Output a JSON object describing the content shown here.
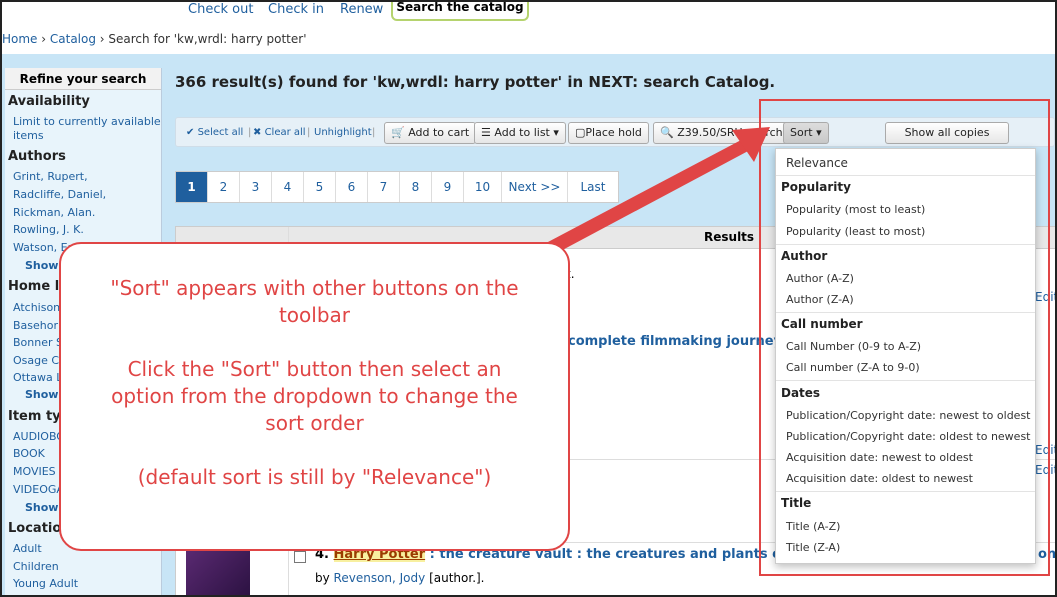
{
  "topnav": {
    "checkout": "Check out",
    "checkin": "Check in",
    "renew": "Renew",
    "search_tab": "Search the catalog"
  },
  "breadcrumb": {
    "home": "Home",
    "sep1": " › ",
    "catalog": "Catalog",
    "sep2": " › ",
    "current": "Search for 'kw,wrdl: harry potter'"
  },
  "sidebar": {
    "refine": "Refine your search",
    "availability": "Availability",
    "avail_link1": "Limit to currently available",
    "avail_link2": "items",
    "authors": "Authors",
    "authors_list": [
      "Grint, Rupert,",
      "Radcliffe, Daniel,",
      "Rickman, Alan.",
      "Rowling, J. K.",
      "Watson, Em"
    ],
    "show": "Show",
    "home_libraries": "Home lib",
    "libraries": [
      "Atchison",
      "Basehor",
      "Bonner S",
      "Osage Ci",
      "Ottawa L"
    ],
    "item_types": "Item typ",
    "types": [
      "AUDIOBO",
      "BOOK",
      "MOVIES",
      "VIDEOGA"
    ],
    "locations": "Location",
    "locs": [
      "Adult",
      "Children",
      "Young Adult"
    ]
  },
  "results_title": "366 result(s) found for 'kw,wrdl: harry potter' in NEXT: search Catalog.",
  "toolbar": {
    "select_all": "Select all",
    "clear_all": "Clear all",
    "unhighlight": "Unhighlight",
    "add_to_cart": "Add to cart",
    "add_to_list": "Add to list",
    "place_hold": "Place hold",
    "z3950": "Z39.50/SRU search",
    "sort": "Sort",
    "show_all_copies": "Show all copies"
  },
  "pager": {
    "pages": [
      "1",
      "2",
      "3",
      "4",
      "5",
      "6",
      "7",
      "8",
      "9",
      "10"
    ],
    "next": "Next >>",
    "last": "Last"
  },
  "table": {
    "results_header": "Results",
    "frag_t": "t.",
    "frag_title2": "complete filmmaking journey /",
    "row4_num": "4.",
    "row4_title": "Harry Potter",
    "row4_rest": " : the creature vault : the creatures and plants of the",
    "row4_tail": "on",
    "row4_by": "by",
    "row4_author": "Revenson, Jody",
    "row4_role": " [author.].",
    "edit": "Edit"
  },
  "dropdown": {
    "relevance": "Relevance",
    "popularity": "Popularity",
    "pop_most": "Popularity (most to least)",
    "pop_least": "Popularity (least to most)",
    "author": "Author",
    "author_az": "Author (A-Z)",
    "author_za": "Author (Z-A)",
    "callnumber": "Call number",
    "cn_09az": "Call Number (0-9 to A-Z)",
    "cn_za90": "Call number (Z-A to 9-0)",
    "dates": "Dates",
    "pub_new": "Publication/Copyright date: newest to oldest",
    "pub_old": "Publication/Copyright date: oldest to newest",
    "acq_new": "Acquisition date: newest to oldest",
    "acq_old": "Acquisition date: oldest to newest",
    "title": "Title",
    "title_az": "Title (A-Z)",
    "title_za": "Title (Z-A)"
  },
  "callout": {
    "line1": "\"Sort\" appears with other buttons on the",
    "line2": "toolbar",
    "line3": "Click the \"Sort\" button then select an",
    "line4": "option from the dropdown to change the",
    "line5": "sort order",
    "line6": "(default sort is still by \"Relevance\")"
  },
  "colors": {
    "annotation": "#e04545",
    "link": "#1f5f9e",
    "background": "#c8e5f6"
  }
}
